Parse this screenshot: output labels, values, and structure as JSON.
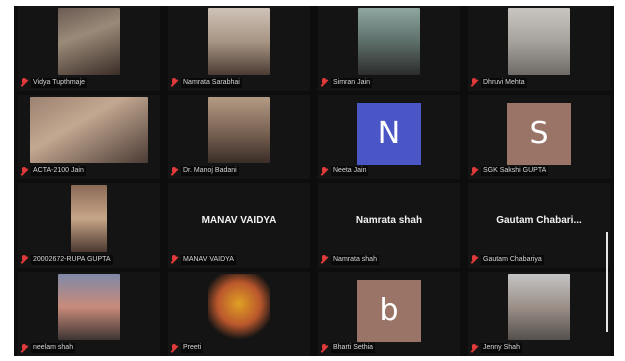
{
  "participants": [
    {
      "name": "Vidya Tupthmaje",
      "type": "video",
      "bg": "linear-gradient(160deg,#6a5a52 0%,#9a8a78 40%,#3b2d28 100%)",
      "vw": 62
    },
    {
      "name": "Namrata Sarabhai",
      "type": "video",
      "bg": "linear-gradient(180deg,#cfc3b8 0%,#a89584 50%,#4a3b33 100%)",
      "vw": 62
    },
    {
      "name": "Simran Jain",
      "type": "video",
      "bg": "linear-gradient(180deg,#8fa7a0 0%,#5d6f6a 50%,#2c2c2c 100%)",
      "vw": 62
    },
    {
      "name": "Dhruvi Mehta",
      "type": "video",
      "bg": "linear-gradient(180deg,#c9c6c1 0%,#a6a29c 50%,#6e6a66 100%)",
      "vw": 62
    },
    {
      "name": "ACTA-2100 Jain",
      "type": "video",
      "bg": "linear-gradient(150deg,#9b8170 0%,#c3a891 40%,#4b3b35 100%)",
      "vw": 118
    },
    {
      "name": "Dr. Manoj Badani",
      "type": "video",
      "bg": "linear-gradient(180deg,#b39b85 0%,#7d6656 50%,#3a2d27 100%)",
      "vw": 62
    },
    {
      "name": "Neeta Jain",
      "type": "avatar",
      "letter": "N",
      "color": "#4a56c6"
    },
    {
      "name": "SGK Sakshi GUPTA",
      "type": "avatar",
      "letter": "S",
      "color": "#9a7467"
    },
    {
      "name": "20002672-RUPA GUPTA",
      "type": "video",
      "bg": "linear-gradient(180deg,#8a6a56 0%,#c7a688 50%,#4a382f 100%)",
      "vw": 36
    },
    {
      "name": "MANAV VAIDYA",
      "type": "text",
      "display": "MANAV VAIDYA"
    },
    {
      "name": "Namrata shah",
      "type": "text",
      "display": "Namrata shah"
    },
    {
      "name": "Gautam Chabariya",
      "type": "text",
      "display": "Gautam Chabari..."
    },
    {
      "name": "neelam shah",
      "type": "video",
      "bg": "linear-gradient(180deg,#7f8aa8 0%,#c98a7a 50%,#3d3533 100%)",
      "vw": 62
    },
    {
      "name": "Preeti",
      "type": "video",
      "bg": "radial-gradient(circle at 50% 45%,#e0a024 0%,#b9572c 45%,#141414 75%)",
      "vw": 62
    },
    {
      "name": "Bharti Sethia",
      "type": "avatar",
      "letter": "b",
      "color": "#9a7467"
    },
    {
      "name": "Jenny Shah",
      "type": "video",
      "bg": "linear-gradient(180deg,#c4c4c4 0%,#9b8f88 50%,#55504c 100%)",
      "vw": 62
    }
  ]
}
